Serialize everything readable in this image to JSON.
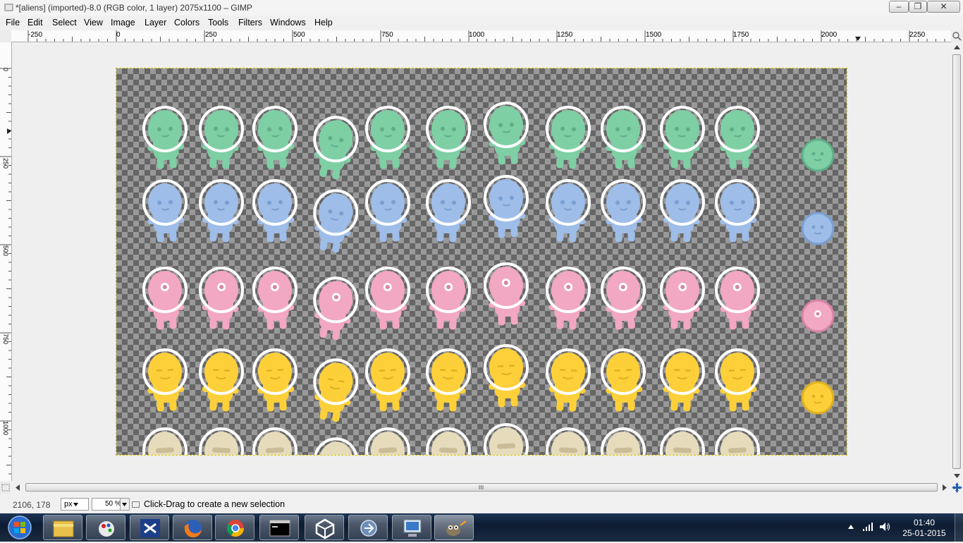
{
  "window": {
    "title": "*[aliens] (imported)-8.0 (RGB color, 1 layer) 2075x1100 – GIMP",
    "minimize_glyph": "–",
    "maximize_glyph": "❐",
    "close_glyph": "✕"
  },
  "menu": [
    {
      "label": "File"
    },
    {
      "label": "Edit"
    },
    {
      "label": "Select"
    },
    {
      "label": "View"
    },
    {
      "label": "Image"
    },
    {
      "label": "Layer"
    },
    {
      "label": "Colors"
    },
    {
      "label": "Tools"
    },
    {
      "label": "Filters"
    },
    {
      "label": "Windows"
    },
    {
      "label": "Help"
    }
  ],
  "ruler": {
    "h_labels": [
      "-250",
      "0",
      "250",
      "500",
      "750",
      "1000",
      "1250",
      "1500",
      "1750",
      "2000",
      "2250"
    ],
    "v_labels": [
      "0",
      "250",
      "500",
      "750",
      "1000"
    ]
  },
  "canvas": {
    "rows": [
      {
        "color": "#7fcfa5",
        "dark": "#5fae88"
      },
      {
        "color": "#9ebde8",
        "dark": "#7a9fd2"
      },
      {
        "color": "#f2a7c3",
        "dark": "#d784a6"
      },
      {
        "color": "#fdd03a",
        "dark": "#e0b020"
      },
      {
        "color": "#e6dcbc",
        "dark": "#c9bc96"
      }
    ]
  },
  "status": {
    "coords": "2106, 178",
    "unit": "px",
    "zoom": "50 %",
    "message": "Click-Drag to create a new selection"
  },
  "taskbar": {
    "apps": [
      {
        "name": "start-orb-icon"
      },
      {
        "name": "explorer-icon"
      },
      {
        "name": "paint-icon"
      },
      {
        "name": "visual-studio-icon"
      },
      {
        "name": "firefox-icon"
      },
      {
        "name": "chrome-icon"
      },
      {
        "name": "cmd-icon"
      },
      {
        "name": "unity-icon"
      },
      {
        "name": "app-icon"
      },
      {
        "name": "computer-icon"
      },
      {
        "name": "gimp-icon"
      }
    ],
    "time": "01:40",
    "date": "25-01-2015"
  }
}
